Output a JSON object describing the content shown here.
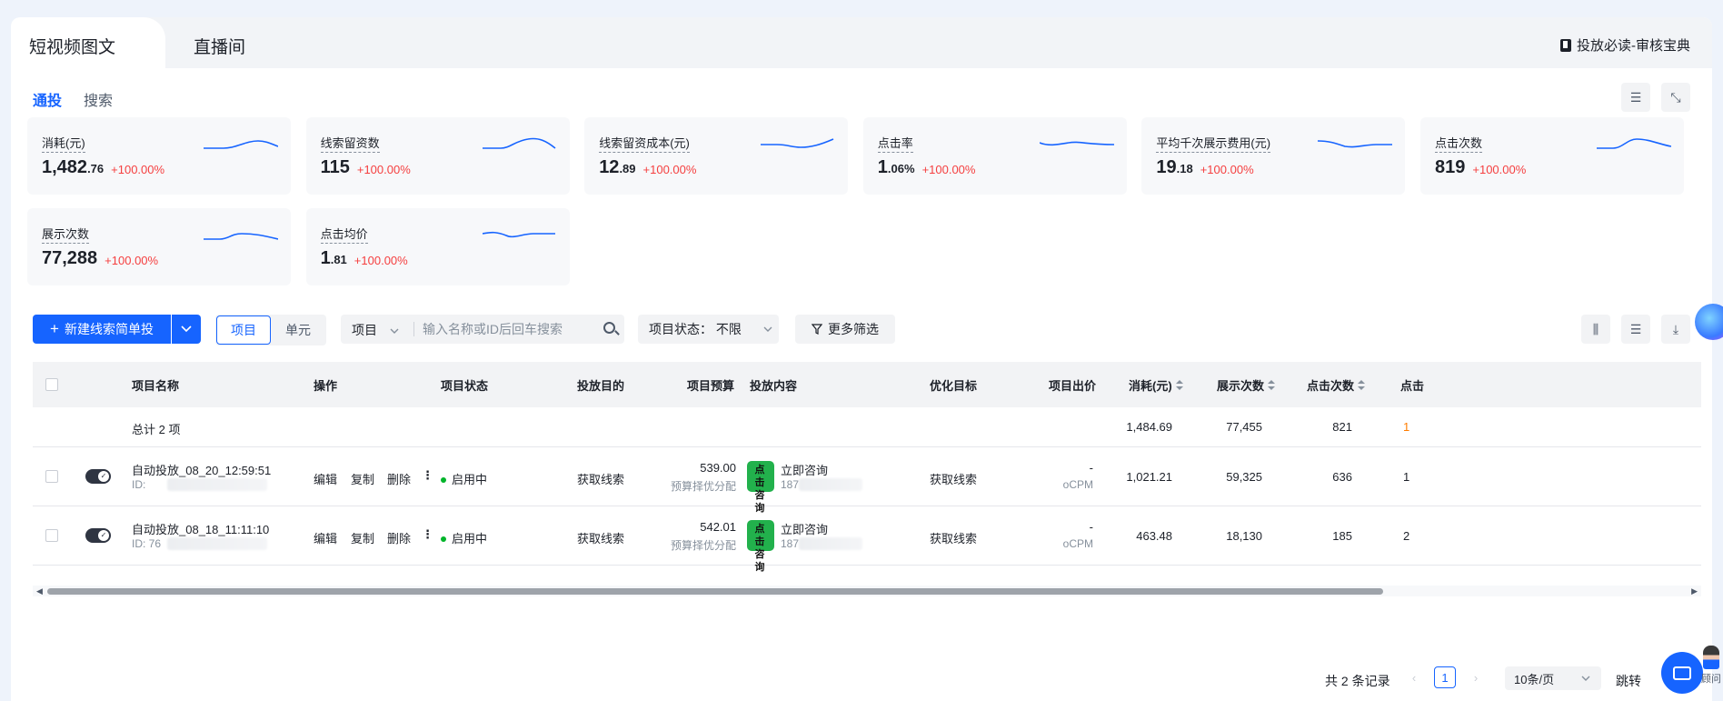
{
  "top_tabs": {
    "active": "短视频图文",
    "inactive": "直播间",
    "guide_link": "投放必读-审核宝典"
  },
  "sub_tabs": {
    "active": "通投",
    "inactive": "搜索"
  },
  "metrics": [
    {
      "label": "消耗(元)",
      "int": "1,482",
      "dec": ".76",
      "change": "+100.00%"
    },
    {
      "label": "线索留资数",
      "int": "115",
      "dec": "",
      "change": "+100.00%"
    },
    {
      "label": "线索留资成本(元)",
      "int": "12",
      "dec": ".89",
      "change": "+100.00%"
    },
    {
      "label": "点击率",
      "int": "1",
      "dec": ".06%",
      "change": "+100.00%"
    },
    {
      "label": "平均千次展示费用(元)",
      "int": "19",
      "dec": ".18",
      "change": "+100.00%"
    },
    {
      "label": "点击次数",
      "int": "819",
      "dec": "",
      "change": "+100.00%"
    },
    {
      "label": "展示次数",
      "int": "77,288",
      "dec": "",
      "change": "+100.00%"
    },
    {
      "label": "点击均价",
      "int": "1",
      "dec": ".81",
      "change": "+100.00%"
    }
  ],
  "toolbar": {
    "new_button": "新建线索简单投",
    "seg_active": "项目",
    "seg_inactive": "单元",
    "search_type": "项目",
    "search_placeholder": "输入名称或ID后回车搜索",
    "status_filter": "项目状态：  不限",
    "more_filter": "更多筛选"
  },
  "table": {
    "headers": {
      "name": "项目名称",
      "ops": "操作",
      "status": "项目状态",
      "goal": "投放目的",
      "budget": "项目预算",
      "content": "投放内容",
      "target": "优化目标",
      "bid": "项目出价",
      "cost": "消耗(元)",
      "impr": "展示次数",
      "clicks": "点击次数",
      "partial": "点击"
    },
    "total": {
      "label": "总计 2 项",
      "cost": "1,484.69",
      "impr": "77,455",
      "clicks": "821",
      "partial": "1"
    },
    "rows": [
      {
        "name": "自动投放_08_20_12:59:51",
        "id": "ID:",
        "op_edit": "编辑",
        "op_copy": "复制",
        "op_delete": "删除",
        "op_more": "⋮",
        "status": "启用中",
        "goal": "获取线索",
        "budget": "539.00",
        "budget_note": "预算择优分配",
        "thumb_text": "点 击 咨 询",
        "content_title": "立即咨询",
        "content_id": "187",
        "target": "获取线索",
        "bid": "-",
        "bid_type": "oCPM",
        "cost": "1,021.21",
        "impr": "59,325",
        "clicks": "636",
        "partial": "1"
      },
      {
        "name": "自动投放_08_18_11:11:10",
        "id": "ID: 76",
        "op_edit": "编辑",
        "op_copy": "复制",
        "op_delete": "删除",
        "op_more": "⋮",
        "status": "启用中",
        "goal": "获取线索",
        "budget": "542.01",
        "budget_note": "预算择优分配",
        "thumb_text": "点 击 咨 询",
        "content_title": "立即咨询",
        "content_id": "187",
        "target": "获取线索",
        "bid": "-",
        "bid_type": "oCPM",
        "cost": "463.48",
        "impr": "18,130",
        "clicks": "185",
        "partial": "2"
      }
    ]
  },
  "pagination": {
    "total_text": "共 2 条记录",
    "current": "1",
    "page_size": "10条/页",
    "jump": "跳转"
  },
  "consultant_label": "顾问",
  "colors": {
    "accent": "#1664ff",
    "up": "#f53f3f",
    "active_status": "#00b42a",
    "spark": "#1664ff"
  }
}
